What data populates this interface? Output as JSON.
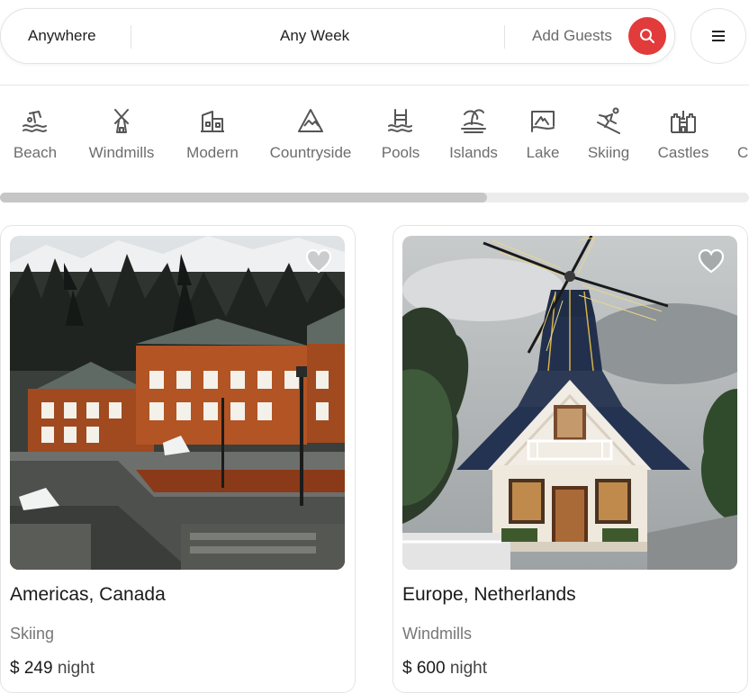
{
  "search": {
    "where": "Anywhere",
    "week": "Any Week",
    "guests": "Add Guests"
  },
  "categories": [
    {
      "label": "Beach",
      "icon": "beach-icon"
    },
    {
      "label": "Windmills",
      "icon": "windmill-icon"
    },
    {
      "label": "Modern",
      "icon": "modern-house-icon"
    },
    {
      "label": "Countryside",
      "icon": "countryside-icon"
    },
    {
      "label": "Pools",
      "icon": "pool-icon"
    },
    {
      "label": "Islands",
      "icon": "island-icon"
    },
    {
      "label": "Lake",
      "icon": "lake-icon"
    },
    {
      "label": "Skiing",
      "icon": "skiing-icon"
    },
    {
      "label": "Castles",
      "icon": "castle-icon"
    },
    {
      "label": "C",
      "icon": "cut-off-icon"
    }
  ],
  "scroll": {
    "visible_fraction": 0.65
  },
  "listings": [
    {
      "location": "Americas, Canada",
      "category": "Skiing",
      "price": "$ 249",
      "unit": "night",
      "photo": "mountain lodge photo"
    },
    {
      "location": "Europe, Netherlands",
      "category": "Windmills",
      "price": "$ 600",
      "unit": "night",
      "photo": "windmill house photo"
    }
  ],
  "colors": {
    "accent": "#e23b3b",
    "muted": "#6d6d6d"
  }
}
